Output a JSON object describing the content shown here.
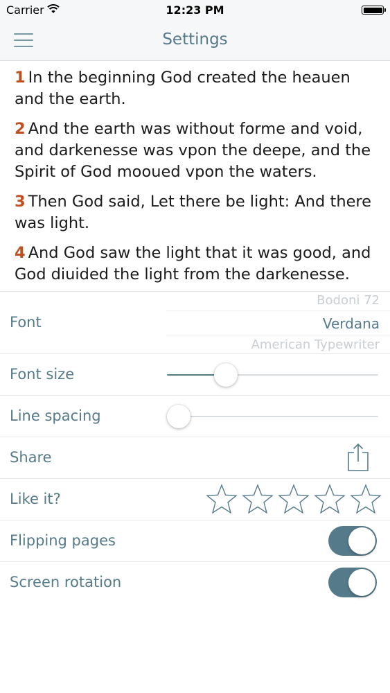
{
  "status_bar": {
    "carrier": "Carrier",
    "time": "12:23 PM",
    "wifi_icon": "wifi-icon",
    "battery_icon": "battery-icon"
  },
  "nav": {
    "title": "Settings",
    "menu_icon": "hamburger-menu-icon"
  },
  "reader": {
    "verses": [
      {
        "num": "1",
        "text": "In the beginning God created the heauen and the earth."
      },
      {
        "num": "2",
        "text": "And the earth was without forme and void, and darkenesse was vpon the deepe, and the Spirit of God mooued vpon the waters."
      },
      {
        "num": "3",
        "text": "Then God said, Let there be light: And there was light."
      },
      {
        "num": "4",
        "text": "And God saw the light that it was good, and God diuided the light from the darkenesse."
      }
    ]
  },
  "settings": {
    "font": {
      "label": "Font",
      "options_visible": [
        "Bodoni 72",
        "Verdana",
        "American Typewriter"
      ],
      "selected": "Verdana"
    },
    "font_size": {
      "label": "Font size",
      "value_fraction": 0.25
    },
    "line_spacing": {
      "label": "Line spacing",
      "value_fraction": 0.0
    },
    "share": {
      "label": "Share",
      "icon": "share-icon"
    },
    "like": {
      "label": "Like it?",
      "stars_total": 5,
      "stars_filled": 0,
      "icon": "star-outline-icon"
    },
    "flipping_pages": {
      "label": "Flipping pages",
      "on": true
    },
    "screen_rotation": {
      "label": "Screen rotation",
      "on": true
    }
  },
  "colors": {
    "accent": "#557a8a",
    "verse_number": "#c0501f",
    "body_text": "#1b1b1b",
    "bar_background": "#f6f7f8"
  }
}
